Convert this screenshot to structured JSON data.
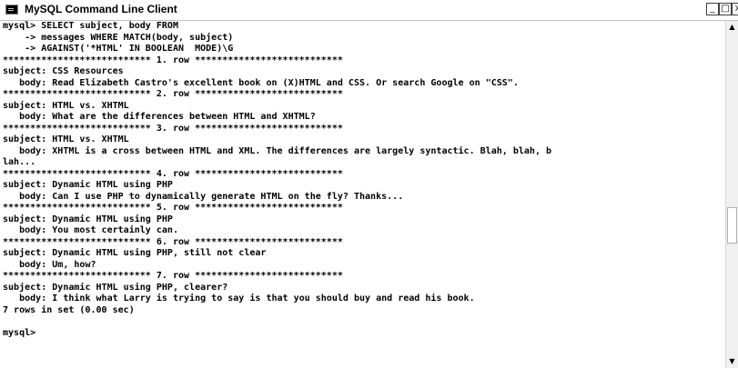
{
  "window": {
    "title": "MySQL Command Line Client",
    "controls": {
      "minimize": "_",
      "maximize": "□",
      "close": "×"
    }
  },
  "console": {
    "lines": [
      "mysql> SELECT subject, body FROM",
      "    -> messages WHERE MATCH(body, subject)",
      "    -> AGAINST('*HTML' IN BOOLEAN  MODE)\\G",
      "*************************** 1. row ***************************",
      "subject: CSS Resources",
      "   body: Read Elizabeth Castro's excellent book on (X)HTML and CSS. Or search Google on \"CSS\".",
      "*************************** 2. row ***************************",
      "subject: HTML vs. XHTML",
      "   body: What are the differences between HTML and XHTML?",
      "*************************** 3. row ***************************",
      "subject: HTML vs. XHTML",
      "   body: XHTML is a cross between HTML and XML. The differences are largely syntactic. Blah, blah, b",
      "lah...",
      "*************************** 4. row ***************************",
      "subject: Dynamic HTML using PHP",
      "   body: Can I use PHP to dynamically generate HTML on the fly? Thanks...",
      "*************************** 5. row ***************************",
      "subject: Dynamic HTML using PHP",
      "   body: You most certainly can.",
      "*************************** 6. row ***************************",
      "subject: Dynamic HTML using PHP, still not clear",
      "   body: Um, how?",
      "*************************** 7. row ***************************",
      "subject: Dynamic HTML using PHP, clearer?",
      "   body: I think what Larry is trying to say is that you should buy and read his book.",
      "7 rows in set (0.00 sec)",
      "",
      "mysql>"
    ]
  },
  "scrollbar": {
    "up_glyph": "▲",
    "down_glyph": "▼"
  }
}
